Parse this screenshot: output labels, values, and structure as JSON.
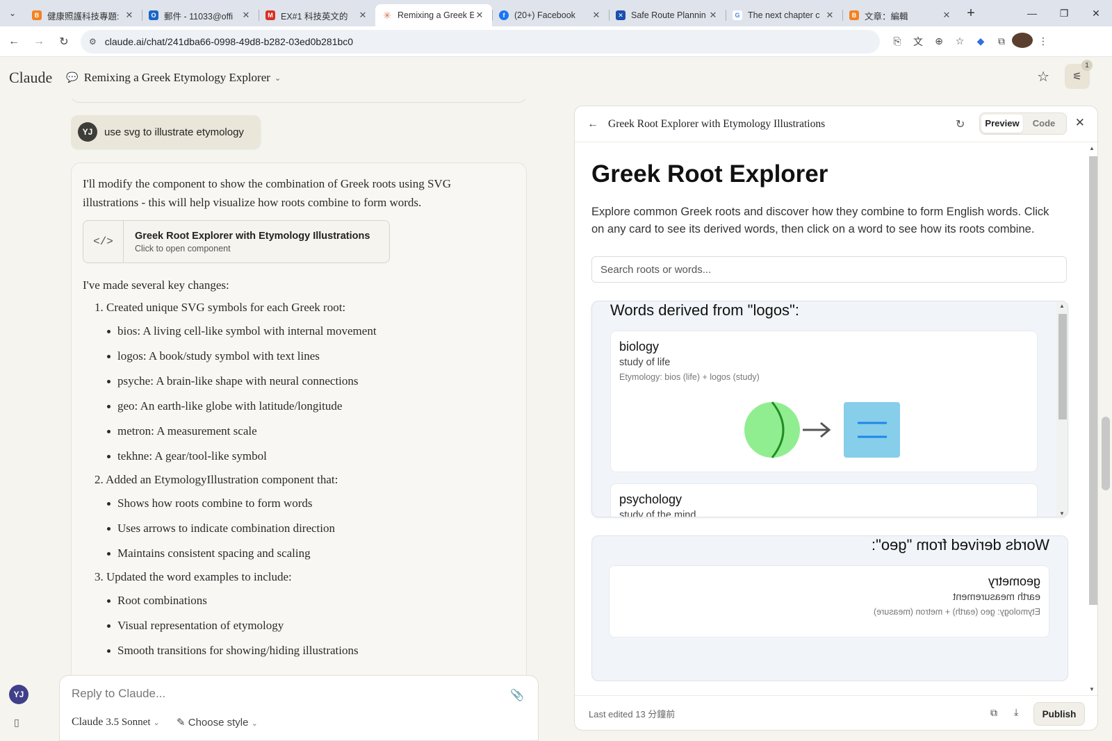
{
  "browser": {
    "tabs": [
      {
        "title": "健康照護科技專題:",
        "icon_color": "#f4811f"
      },
      {
        "title": "郵件 - 11033@offi",
        "icon_color": "#1a66c8"
      },
      {
        "title": "EX#1 科技英文的",
        "icon_color": "#d93025"
      },
      {
        "title": "Remixing a Greek E",
        "icon_color": "#d97757",
        "active": true
      },
      {
        "title": "(20+) Facebook",
        "icon_color": "#1877f2"
      },
      {
        "title": "Safe Route Plannin",
        "icon_color": "#1a4fb0"
      },
      {
        "title": "The next chapter c",
        "icon_color": "#4285f4"
      },
      {
        "title": "文章：編輯",
        "icon_color": "#f4811f"
      }
    ],
    "url": "claude.ai/chat/241dba66-0998-49d8-b282-03ed0b281bc0"
  },
  "header": {
    "logo": "Claude",
    "chat_title": "Remixing a Greek Etymology Explorer",
    "settings_badge": "1"
  },
  "chat": {
    "user_initials": "YJ",
    "user_message": "use svg to illustrate etymology",
    "intro": "I'll modify the component to show the combination of Greek roots using SVG illustrations - this will help visualize how roots combine to form words.",
    "artifact": {
      "title": "Greek Root Explorer with Etymology Illustrations",
      "subtitle": "Click to open component"
    },
    "changes_heading": "I've made several key changes:",
    "points": [
      {
        "label": "1. Created unique SVG symbols for each Greek root:",
        "items": [
          "bios: A living cell-like symbol with internal movement",
          "logos: A book/study symbol with text lines",
          "psyche: A brain-like shape with neural connections",
          "geo: An earth-like globe with latitude/longitude",
          "metron: A measurement scale",
          "tekhne: A gear/tool-like symbol"
        ]
      },
      {
        "label": "2. Added an EtymologyIllustration component that:",
        "items": [
          "Shows how roots combine to form words",
          "Uses arrows to indicate combination direction",
          "Maintains consistent spacing and scaling"
        ]
      },
      {
        "label": "3. Updated the word examples to include:",
        "items": [
          "Root combinations",
          "Visual representation of etymology",
          "Smooth transitions for showing/hiding illustrations"
        ]
      }
    ]
  },
  "composer": {
    "placeholder": "Reply to Claude...",
    "model": "Claude",
    "model_version": "3.5 Sonnet",
    "style": "Choose style"
  },
  "artifact_panel": {
    "title": "Greek Root Explorer with Etymology Illustrations",
    "preview_label": "Preview",
    "code_label": "Code",
    "footer_edited": "Last edited 13 分鐘前",
    "publish_label": "Publish",
    "app": {
      "title": "Greek Root Explorer",
      "description": "Explore common Greek roots and discover how they combine to form English words. Click on any card to see its derived words, then click on a word to see how its roots combine.",
      "search_placeholder": "Search roots or words...",
      "words_title_1": "Words derived from \"logos\":",
      "word_1": {
        "name": "biology",
        "def": "study of life",
        "ety": "Etymology: bios (life) + logos (study)"
      },
      "word_2": {
        "name": "psychology",
        "def": "study of the mind"
      },
      "words_title_2": "Words derived from \"geo\":",
      "word_3": {
        "name": "geometry",
        "def": "earth measurement",
        "ety": "Etymology: geo (earth) + metron (measure)"
      }
    }
  },
  "colors": {
    "bios_green": "#90ee90",
    "logos_blue": "#87ceeb"
  }
}
